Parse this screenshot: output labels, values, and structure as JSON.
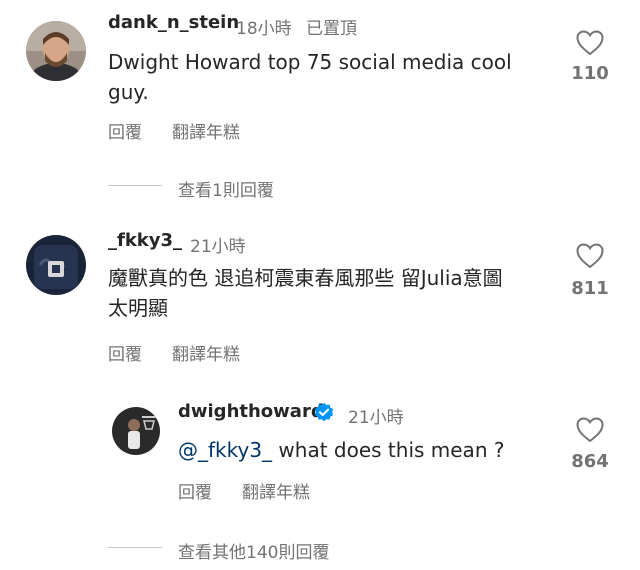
{
  "comments": [
    {
      "username": "dank_n_stein",
      "time": "18小時",
      "pinned": "已置頂",
      "text_line1": "Dwight Howard top 75 social media cool",
      "text_line2": "guy.",
      "reply": "回覆",
      "translate": "翻譯年糕",
      "likes": "110",
      "view_replies": "查看1則回覆"
    },
    {
      "username": "_fkky3_",
      "time": "21小時",
      "text_line1": "魔獸真的色 退追柯震東春風那些 留Julia意圖",
      "text_line2": "太明顯",
      "reply": "回覆",
      "translate": "翻譯年糕",
      "likes": "811"
    }
  ],
  "reply_comment": {
    "username": "dwighthoward",
    "time": "21小時",
    "mention": "@_fkky3_",
    "text": " what does this mean ?",
    "reply": "回覆",
    "translate": "翻譯年糕",
    "likes": "864"
  },
  "view_more": "查看其他140則回覆",
  "colors": {
    "text": "#262626",
    "secondary": "#737373",
    "verified": "#0095f6",
    "mention": "#00376b"
  },
  "icons": [
    "heart-icon",
    "verified-badge-icon"
  ]
}
